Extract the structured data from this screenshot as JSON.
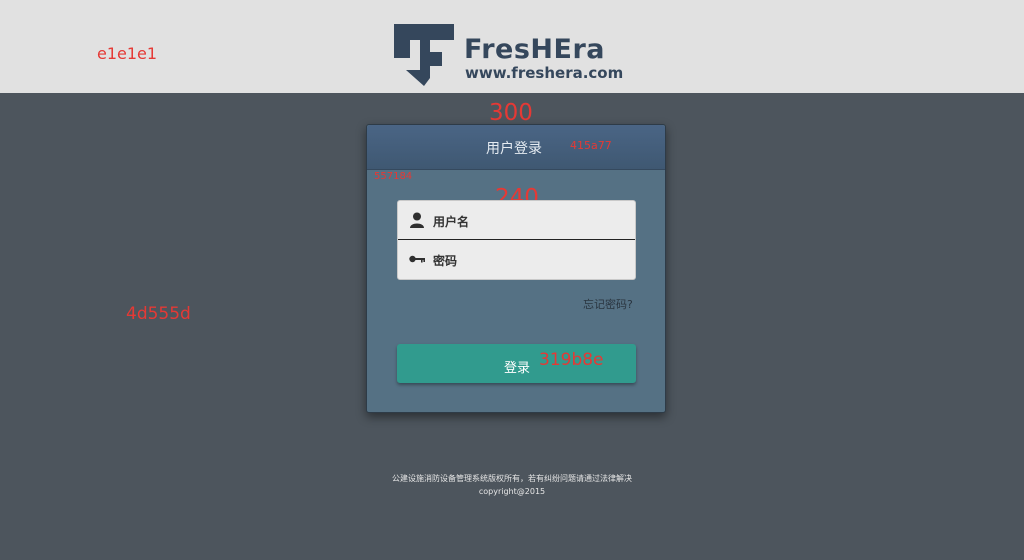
{
  "annotations": {
    "header_color": "e1e1e1",
    "body_color": "4d555d",
    "card_width": "300",
    "card_header_color": "415a77",
    "card_body_color": "557184",
    "form_width": "240",
    "button_color": "319b8e"
  },
  "brand": {
    "name": "FresHEra",
    "url": "www.freshera.com",
    "color": "#35475c"
  },
  "login": {
    "title": "用户登录",
    "username_placeholder": "用户名",
    "password_placeholder": "密码",
    "forgot_label": "忘记密码?",
    "submit_label": "登录",
    "user_icon": "user-icon",
    "key_icon": "key-icon"
  },
  "footer": {
    "rights": "公建设施消防设备管理系统版权所有，若有纠纷问题请通过法律解决",
    "copyright": "copyright@2015"
  },
  "colors": {
    "header_bg": "#e1e1e1",
    "page_bg": "#4d555d",
    "card_head": "#415a77",
    "card_body": "#557184",
    "button": "#319b8e",
    "annotation": "#e53935"
  }
}
